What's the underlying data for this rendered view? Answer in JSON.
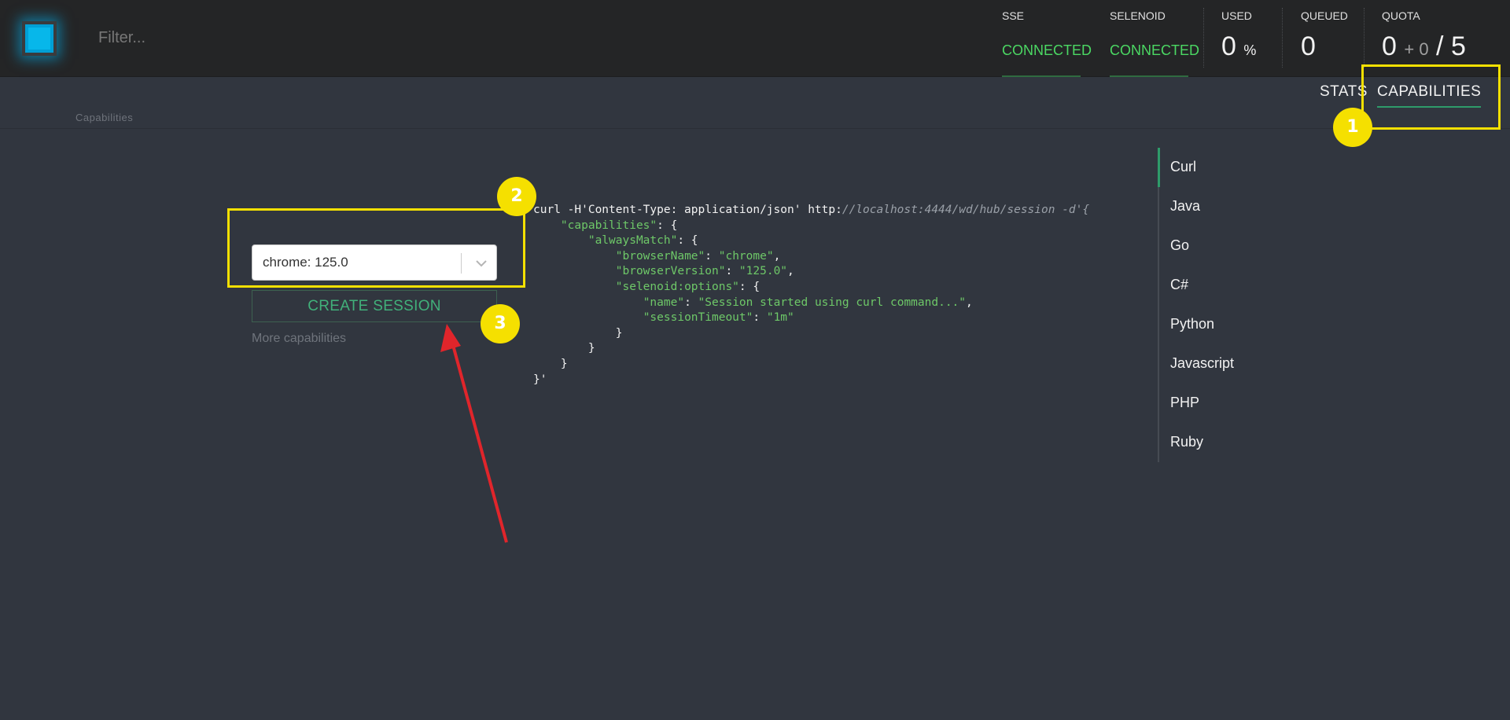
{
  "header": {
    "filter_placeholder": "Filter...",
    "sse": {
      "label": "SSE",
      "value": "CONNECTED"
    },
    "selenoid": {
      "label": "SELENOID",
      "value": "CONNECTED"
    },
    "used": {
      "label": "USED",
      "value": "0",
      "unit": "%"
    },
    "queued": {
      "label": "QUEUED",
      "value": "0"
    },
    "quota": {
      "label": "QUOTA",
      "current": "0",
      "plus": "+ 0",
      "sep": "/",
      "total": "5"
    }
  },
  "nav": {
    "stats": "STATS",
    "capabilities": "CAPABILITIES"
  },
  "breadcrumb": "Capabilities",
  "form": {
    "browser_selected": "chrome: 125.0",
    "create_label": "CREATE SESSION",
    "more_label": "More capabilities"
  },
  "code": {
    "l1_cmd": "curl -H'Content-Type: application/json' http:",
    "l1_url": "//localhost:4444/wd/hub/session -d'{",
    "k_capabilities": "\"capabilities\"",
    "k_alwaysMatch": "\"alwaysMatch\"",
    "k_browserName": "\"browserName\"",
    "v_browserName": "\"chrome\"",
    "k_browserVersion": "\"browserVersion\"",
    "v_browserVersion": "\"125.0\"",
    "k_selenoid": "\"selenoid:options\"",
    "k_name": "\"name\"",
    "v_name": "\"Session started using curl command...\"",
    "k_timeout": "\"sessionTimeout\"",
    "v_timeout": "\"1m\"",
    "end": "}'"
  },
  "languages": [
    "Curl",
    "Java",
    "Go",
    "C#",
    "Python",
    "Javascript",
    "PHP",
    "Ruby"
  ],
  "annotations": [
    "1",
    "2",
    "3"
  ],
  "colors": {
    "accent": "#2e9b6a",
    "connected": "#4bd863",
    "annotation": "#f5e000",
    "arrow": "#e0252b"
  }
}
